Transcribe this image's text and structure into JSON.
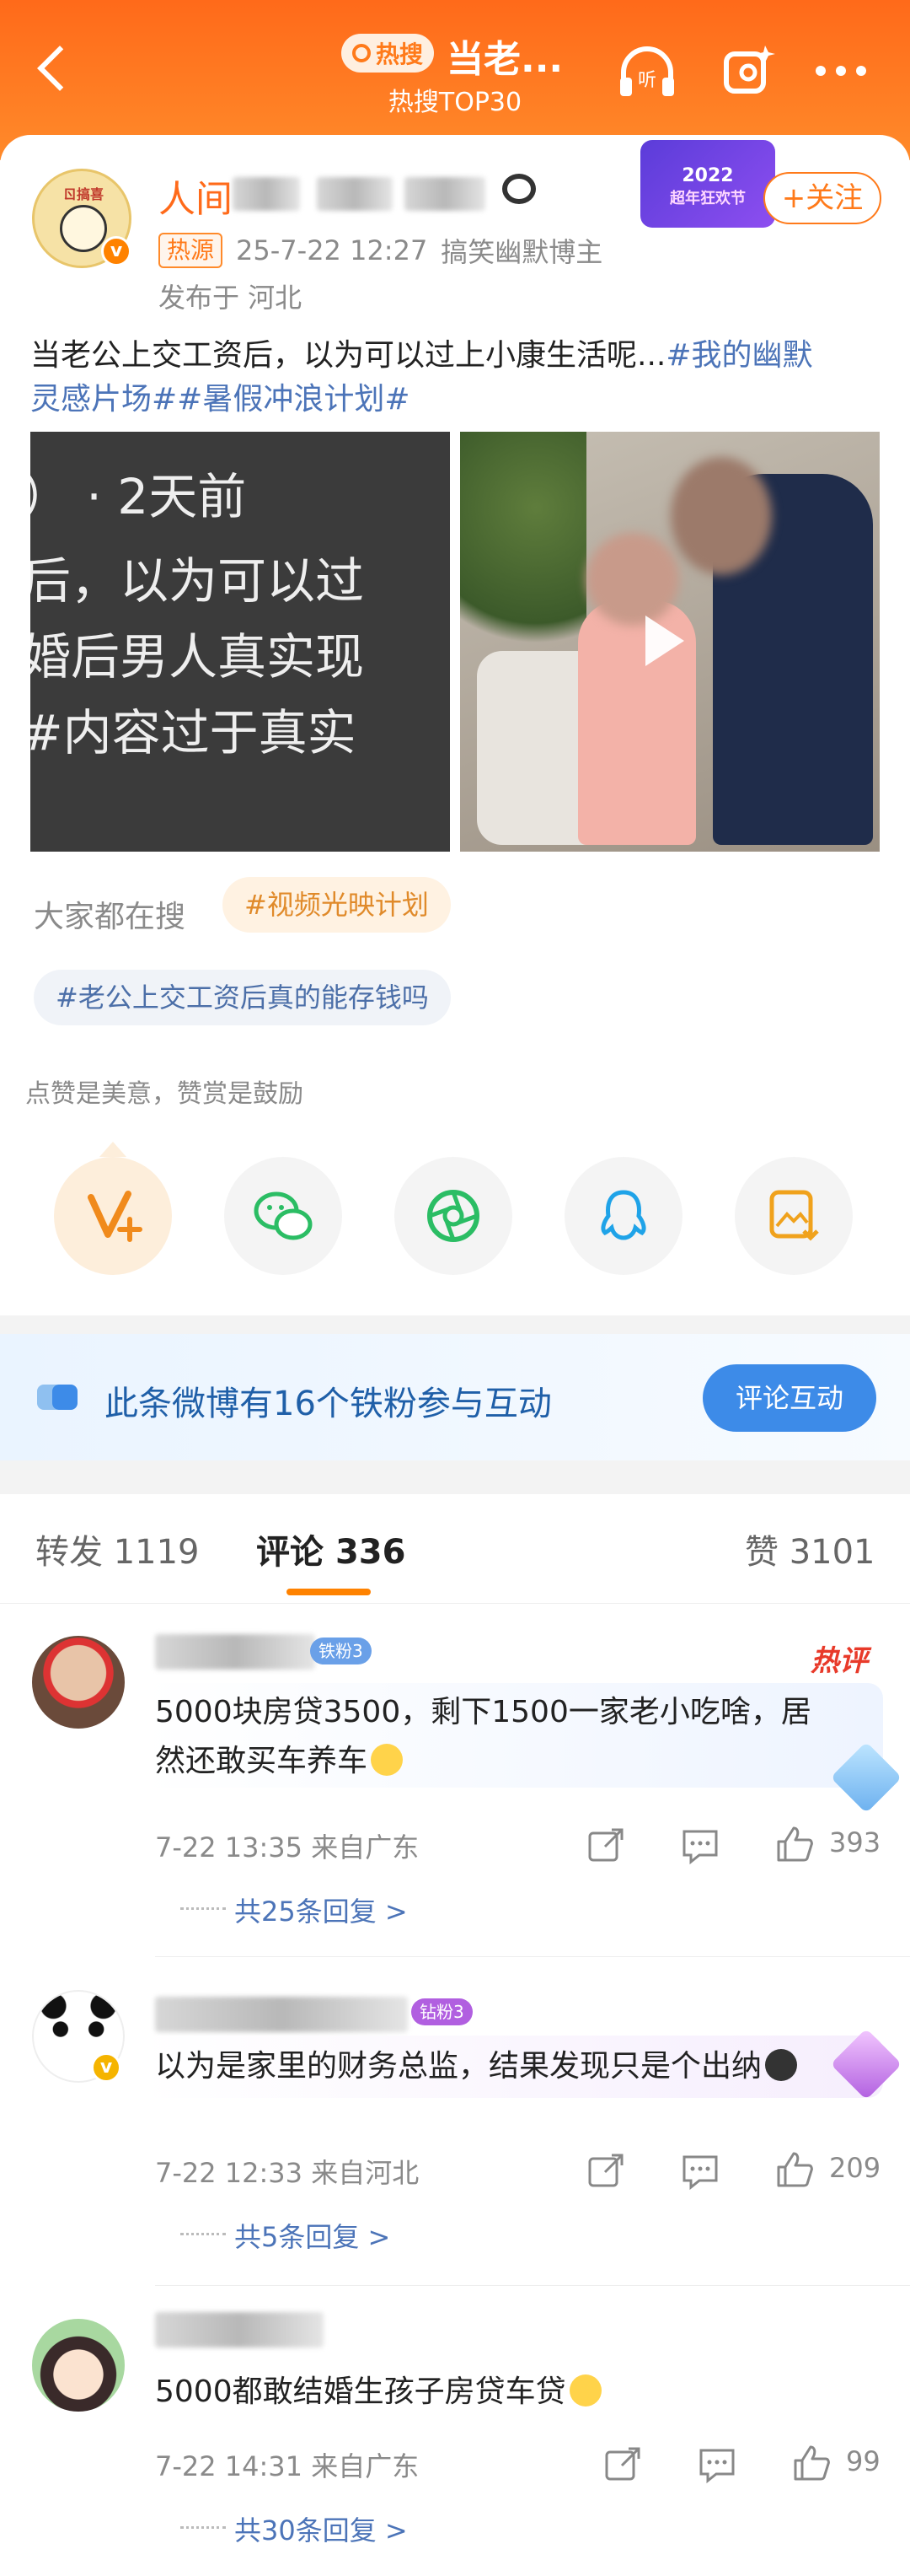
{
  "header": {
    "badge": "热搜",
    "title": "当老...",
    "subtitle": "热搜TOP30",
    "listen_label": "听"
  },
  "post": {
    "username_visible": "人间",
    "source_badge": "热源",
    "time": "25-7-22 12:27",
    "category": "搞笑幽默博主",
    "location": "发布于 河北",
    "follow": "+关注",
    "promo_year": "2022",
    "promo_text": "超年狂欢节",
    "text_line1_plain": "当老公上交工资后，以为可以过上小康生活呢...",
    "text_line1_tag": "#我的幽默",
    "text_line2_tag": "灵感片场##暑假冲浪计划#",
    "image_left_lines": [
      "）  · 2天前",
      "后，以为可以过",
      "婚后男人真实现",
      "#内容过于真实"
    ]
  },
  "search": {
    "label": "大家都在搜",
    "tags": [
      "#视频光映计划",
      "#老公上交工资后真的能存钱吗"
    ]
  },
  "reward": {
    "label": "点赞是美意，赞赏是鼓励",
    "icons": [
      "v-plus-icon",
      "wechat-icon",
      "moments-icon",
      "qq-icon",
      "save-image-icon"
    ]
  },
  "fans_banner": {
    "text": "此条微博有16个铁粉参与互动",
    "button": "评论互动"
  },
  "tabs": {
    "repost": "转发 1119",
    "comment_label": "评论",
    "comment_count": "336",
    "like": "赞 3101"
  },
  "comments": [
    {
      "fan_level": "铁粉3",
      "hot": "热评",
      "text_line1": "5000块房贷3500，剩下1500一家老小吃啥，居",
      "text_line2": "然还敢买车养车",
      "time_loc": "7-22 13:35  来自广东",
      "likes": "393",
      "replies": "共25条回复 >"
    },
    {
      "fan_level": "钻粉3",
      "text_line1": "以为是家里的财务总监，结果发现只是个出纳",
      "time_loc": "7-22 12:33  来自河北",
      "likes": "209",
      "replies": "共5条回复 >"
    },
    {
      "text_line1": "5000都敢结婚生孩子房贷车贷",
      "time_loc": "7-22 14:31  来自广东",
      "likes": "99",
      "replies": "共30条回复 >"
    }
  ],
  "colors": {
    "header_orange": "#ff7a1a",
    "link_blue": "#4c74b8",
    "fans_button": "#3d8be8",
    "hot_red": "#e83a2a"
  }
}
